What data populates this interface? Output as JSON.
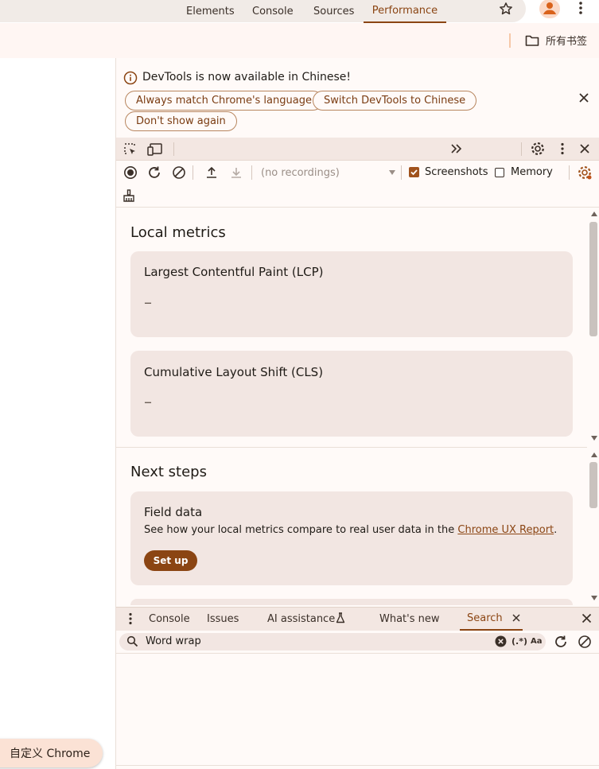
{
  "browser": {
    "bookmarks_folder": "所有书签",
    "customize_button": "自定义 Chrome"
  },
  "infobar": {
    "message": "DevTools is now available in Chinese!",
    "buttons": [
      "Always match Chrome's language",
      "Switch DevTools to Chinese",
      "Don't show again"
    ]
  },
  "devtools": {
    "tabs": [
      "Elements",
      "Console",
      "Sources",
      "Performance"
    ],
    "active_tab": "Performance",
    "toolbar": {
      "recordings_select": "(no recordings)",
      "screenshots_label": "Screenshots",
      "screenshots_checked": true,
      "memory_label": "Memory",
      "memory_checked": false
    },
    "local_metrics": {
      "heading": "Local metrics",
      "cards": [
        {
          "title": "Largest Contentful Paint (LCP)",
          "value": "–"
        },
        {
          "title": "Cumulative Layout Shift (CLS)",
          "value": "–"
        }
      ]
    },
    "next_steps": {
      "heading": "Next steps",
      "field_data": {
        "title": "Field data",
        "text_before": "See how your local metrics compare to real user data in the ",
        "link": "Chrome UX Report",
        "text_after": ".",
        "button": "Set up"
      }
    },
    "drawer": {
      "tabs": [
        "Console",
        "Issues",
        "AI assistance",
        "What's new",
        "Search"
      ],
      "active_tab": "Search",
      "search_value": "Word wrap",
      "regex_label": "(.*)",
      "case_label": "Aa"
    }
  },
  "colors": {
    "accent": "#a0521c",
    "accent_dark": "#8b4513",
    "card_bg": "#f2e6e2",
    "tab_bar": "#f3e7e2"
  }
}
